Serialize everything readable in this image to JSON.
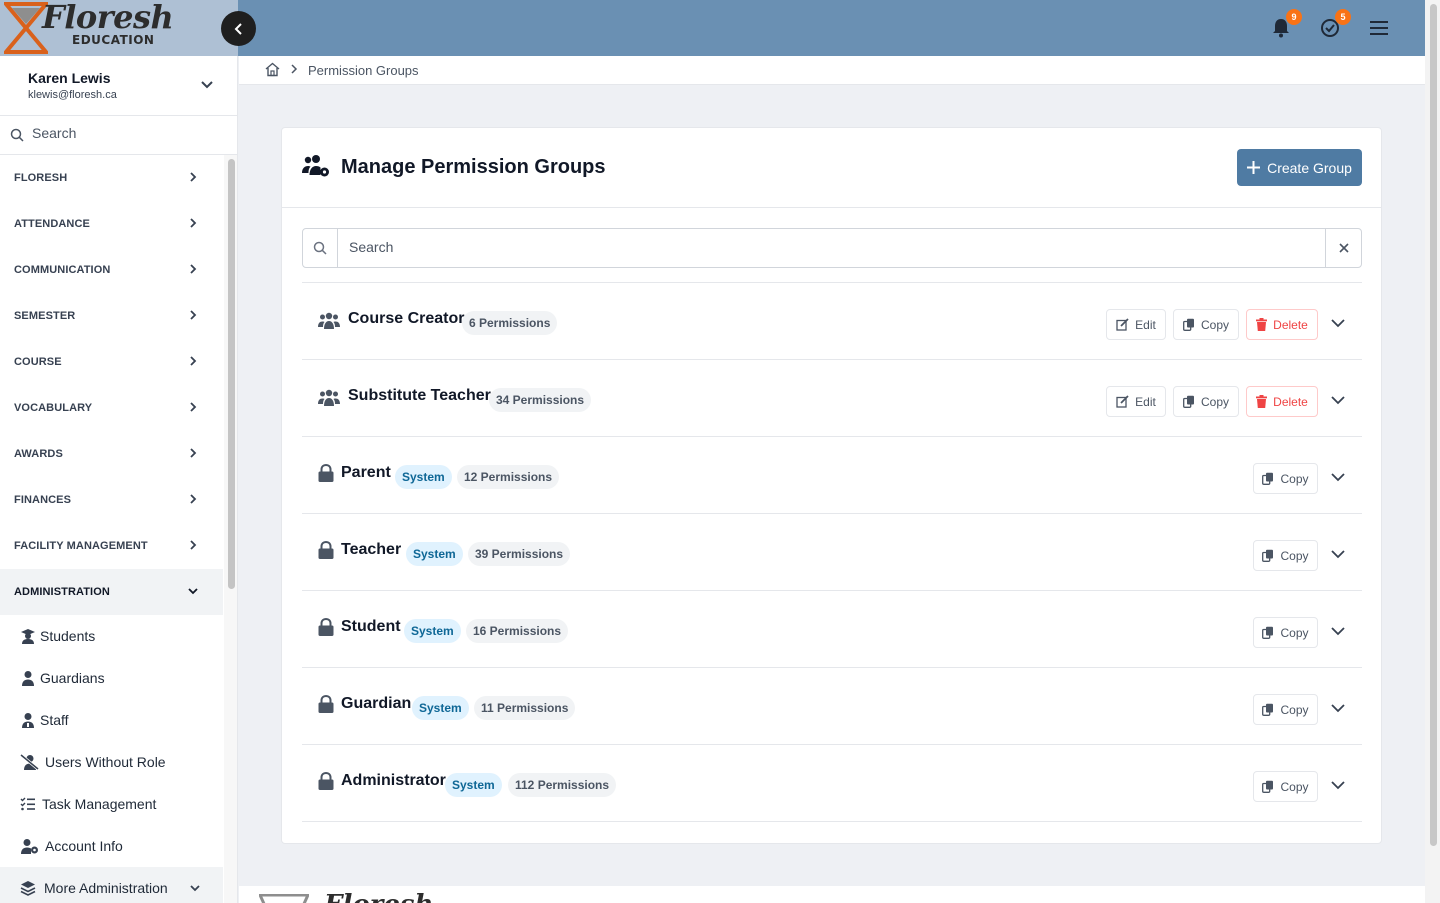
{
  "brand": {
    "logo_text": "Floresh",
    "logo_subtext": "EDUCATION"
  },
  "header": {
    "notifications_count": "9",
    "tasks_count": "5"
  },
  "user": {
    "name": "Karen Lewis",
    "email": "klewis@floresh.ca"
  },
  "sidebar": {
    "search_placeholder": "Search",
    "sections": [
      {
        "label": "FLORESH"
      },
      {
        "label": "ATTENDANCE"
      },
      {
        "label": "COMMUNICATION"
      },
      {
        "label": "SEMESTER"
      },
      {
        "label": "COURSE"
      },
      {
        "label": "VOCABULARY"
      },
      {
        "label": "AWARDS"
      },
      {
        "label": "FINANCES"
      },
      {
        "label": "FACILITY MANAGEMENT"
      },
      {
        "label": "ADMINISTRATION"
      }
    ],
    "admin_items": [
      {
        "label": "Students",
        "icon": "student-icon"
      },
      {
        "label": "Guardians",
        "icon": "person-icon"
      },
      {
        "label": "Staff",
        "icon": "staff-icon"
      },
      {
        "label": "Users Without Role",
        "icon": "user-slash-icon"
      },
      {
        "label": "Task Management",
        "icon": "list-check-icon"
      },
      {
        "label": "Account Info",
        "icon": "user-gear-icon"
      },
      {
        "label": "More Administration",
        "icon": "layers-icon"
      }
    ]
  },
  "breadcrumb": {
    "current": "Permission Groups"
  },
  "page": {
    "title": "Manage Permission Groups",
    "create_button": "Create Group",
    "search_placeholder": "Search"
  },
  "labels": {
    "edit": "Edit",
    "copy": "Copy",
    "delete": "Delete",
    "system": "System"
  },
  "groups": [
    {
      "name": "Course Creator",
      "permissions": "6 Permissions",
      "system": false
    },
    {
      "name": "Substitute Teacher",
      "permissions": "34 Permissions",
      "system": false
    },
    {
      "name": "Parent",
      "permissions": "12 Permissions",
      "system": true
    },
    {
      "name": "Teacher",
      "permissions": "39 Permissions",
      "system": true
    },
    {
      "name": "Student",
      "permissions": "16 Permissions",
      "system": true
    },
    {
      "name": "Guardian",
      "permissions": "11 Permissions",
      "system": true
    },
    {
      "name": "Administrator",
      "permissions": "112 Permissions",
      "system": true
    }
  ],
  "colors": {
    "header": "#6a90b3",
    "primary_button": "#4f7ba3",
    "badge": "#f97316",
    "delete": "#ef4444",
    "system_pill": "#e0f2fe"
  }
}
